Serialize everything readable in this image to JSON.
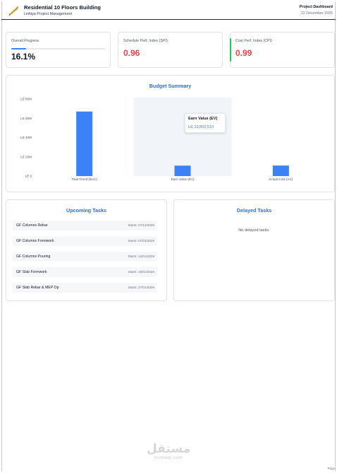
{
  "header": {
    "title": "Residential 10 Floors Building",
    "subtitle": "Linkiya Project Management",
    "right_label": "Project Dashboard",
    "date": "22 December 2025"
  },
  "kpis": {
    "progress": {
      "label": "Overall Progress",
      "value": "16.1%",
      "fraction": 0.161
    },
    "spi": {
      "label": "Schedule Perf. Index (SPI)",
      "value": "0.96",
      "color": "#e0454f"
    },
    "cpi": {
      "label": "Cost Perf. Index (CPI)",
      "value": "0.99",
      "color": "#e0454f",
      "accent": "#22c55e"
    }
  },
  "budget": {
    "title": "Budget Summary",
    "tooltip": {
      "title": "Earn Value (EV)",
      "value": "LE 10,802,510"
    }
  },
  "chart_data": {
    "type": "bar",
    "categories": [
      "Total Trend (BAC)",
      "Earn Value (EV)",
      "Actual Cost (AC)"
    ],
    "values": [
      67000000,
      10802510,
      10900000
    ],
    "yticks": [
      "LE 0",
      "LE 20M",
      "LE 40M",
      "LE 60M",
      "LE 80M"
    ],
    "ylim": [
      0,
      80000000
    ],
    "bar_color": "#3b82f6",
    "highlight_index": 1
  },
  "upcoming": {
    "title": "Upcoming Tasks",
    "tasks": [
      {
        "name": "GF Columns Rebar",
        "date": "Starts: 27/12/2026"
      },
      {
        "name": "GF Columns Formwork",
        "date": "Starts: 07/01/2026"
      },
      {
        "name": "GF Columns Pouring",
        "date": "Starts: 14/01/2026"
      },
      {
        "name": "GF Slab Formwork",
        "date": "Starts: 15/01/2026"
      },
      {
        "name": "GF Slab Rebar & MEP Op",
        "date": "Starts: 27/01/2026"
      }
    ]
  },
  "delayed": {
    "title": "Delayed Tasks",
    "empty": "No delayed tasks."
  },
  "watermark": {
    "arabic": "مستقل",
    "latin": "mostaql.com"
  },
  "footer": {
    "page": "Page"
  }
}
